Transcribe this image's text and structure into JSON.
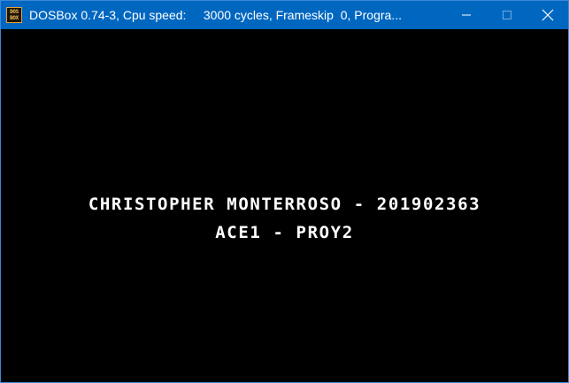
{
  "window": {
    "title": "DOSBox 0.74-3, Cpu speed:     3000 cycles, Frameskip  0, Progra...",
    "icon": "dosbox-icon",
    "icon_text_top": "DOS",
    "icon_text_bottom": "BOX",
    "controls": [
      "minimize-icon",
      "maximize-icon",
      "close-icon"
    ],
    "colors": {
      "titlebar": "#0067c0",
      "title_text": "#ffffff",
      "screen_bg": "#000000",
      "screen_text": "#ffffff"
    }
  },
  "screen": {
    "lines": [
      "CHRISTOPHER MONTERROSO - 201902363",
      "ACE1 - PROY2"
    ]
  }
}
